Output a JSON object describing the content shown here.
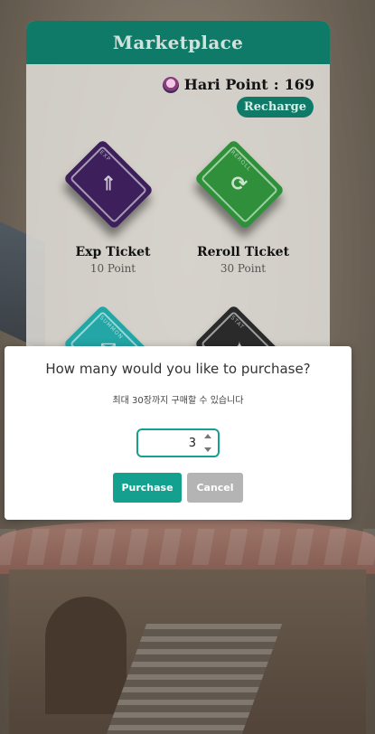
{
  "header": {
    "title": "Marketplace"
  },
  "points": {
    "label": "Hari Point",
    "separator": ":",
    "value": "169"
  },
  "recharge_label": "Recharge",
  "items": [
    {
      "name": "Exp Ticket",
      "price": "10 Point",
      "tag": "EXP",
      "color": "#3d1f5c"
    },
    {
      "name": "Reroll Ticket",
      "price": "30 Point",
      "tag": "REROLL",
      "color": "#2f8f3a"
    },
    {
      "name": "",
      "price": "",
      "tag": "SUMMON",
      "color": "#24a6a6"
    },
    {
      "name": "",
      "price": "",
      "tag": "STAT",
      "color": "#2a2a2a"
    }
  ],
  "modal": {
    "title": "How many would you like to purchase?",
    "subtitle": "최대 30장까지 구매할 수 있습니다",
    "quantity": "3",
    "purchase_label": "Purchase",
    "cancel_label": "Cancel"
  },
  "colors": {
    "accent": "#0f7a68",
    "button_primary": "#14a08f",
    "button_secondary": "#b4b4b4"
  }
}
